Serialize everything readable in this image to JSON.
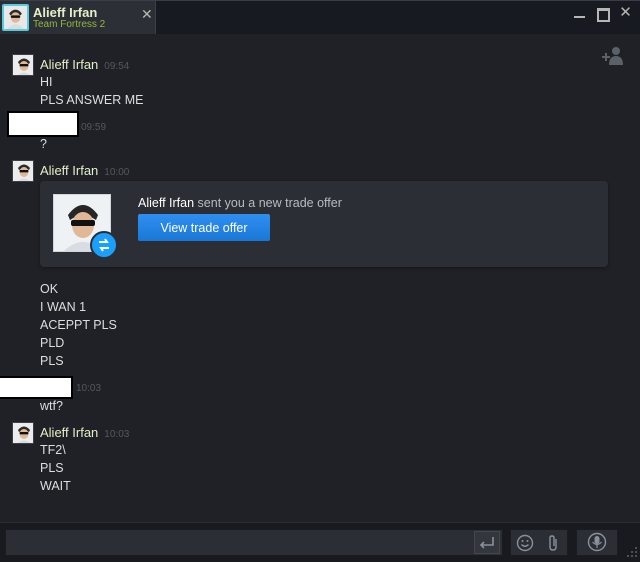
{
  "window": {
    "tab": {
      "name": "Alieff Irfan",
      "game": "Team Fortress 2",
      "close": "✕"
    },
    "controls": {
      "close": "✕"
    }
  },
  "messages": [
    {
      "sender": "Alieff Irfan",
      "time": "09:54",
      "lines": [
        "HI",
        "PLS ANSWER ME"
      ]
    },
    {
      "sender": "",
      "time": "09:59",
      "lines": [
        "?"
      ]
    },
    {
      "sender": "Alieff Irfan",
      "time": "10:00",
      "lines": []
    },
    {
      "sender": "",
      "time": "",
      "lines": [
        "OK",
        "I WAN 1",
        "ACEPPT PLS",
        "PLD",
        "PLS"
      ]
    },
    {
      "sender": "",
      "time": "10:03",
      "lines": [
        "wtf?"
      ]
    },
    {
      "sender": "Alieff Irfan",
      "time": "10:03",
      "lines": [
        "TF2\\",
        "PLS",
        "WAIT"
      ]
    }
  ],
  "trade_offer": {
    "sender_name": "Alieff Irfan",
    "text": "sent you a new trade offer",
    "button_label": "View trade offer"
  },
  "input": {
    "value": "",
    "placeholder": ""
  },
  "colors": {
    "background": "#1f2126",
    "sender_name": "#e3f0c7",
    "game_text": "#8fb93b",
    "timestamp": "#54575c",
    "button_blue": "#1a77d6"
  },
  "icons": [
    "invite-friend-icon",
    "send-icon",
    "emoticon-icon",
    "attachment-icon",
    "voice-chat-icon",
    "resize-grip-icon",
    "trade-icon"
  ]
}
